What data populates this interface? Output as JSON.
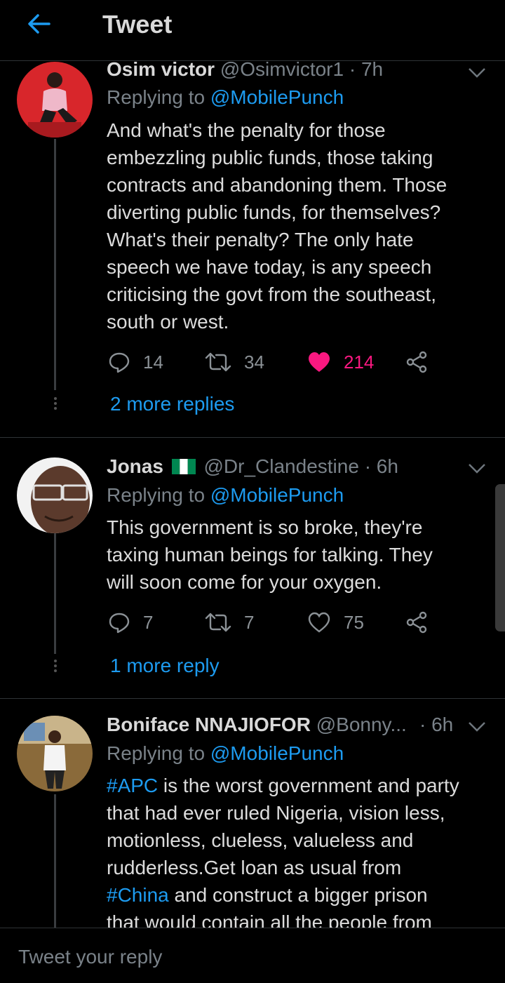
{
  "header": {
    "title": "Tweet"
  },
  "tweets": [
    {
      "name": "Osim victor",
      "handle": "@Osimvictor1",
      "time": "· 7h",
      "replying_prefix": "Replying to",
      "replying_to": "@MobilePunch",
      "text": "And what's the penalty for those\nembezzling public funds, those taking\ncontracts and abandoning them. Those\ndiverting public funds, for themselves?\nWhat's their penalty? The only hate\nspeech we have today, is any speech\ncriticising the govt from the southeast,\nsouth or west.",
      "replies": "14",
      "retweets": "34",
      "likes": "214",
      "liked": true,
      "more_replies": "2 more replies"
    },
    {
      "name": "Jonas",
      "flag": "Nigeria",
      "handle": "@Dr_Clandestine",
      "time": "· 6h",
      "replying_prefix": "Replying to",
      "replying_to": "@MobilePunch",
      "text": "This government is so broke, they're\ntaxing human beings for talking. They\nwill soon come for your oxygen.",
      "replies": "7",
      "retweets": "7",
      "likes": "75",
      "liked": false,
      "more_replies": "1 more reply"
    },
    {
      "name": "Boniface NNAJIOFOR",
      "handle": "@Bonny...",
      "time": "· 6h",
      "replying_prefix": "Replying to",
      "replying_to": "@MobilePunch",
      "hashtag1": "#APC",
      "text_part1": " is the worst government and party\nthat had ever ruled Nigeria, vision less,\nmotionless, clueless, valueless and\nrudderless.Get loan as usual from\n",
      "hashtag2": "#China",
      "text_part2": " and construct a bigger prison\nthat would contain all the people from"
    }
  ],
  "reply_bar": {
    "placeholder": "Tweet your reply"
  },
  "colors": {
    "accent": "#1d9bf0",
    "like": "#f91880",
    "background": "#000000"
  }
}
